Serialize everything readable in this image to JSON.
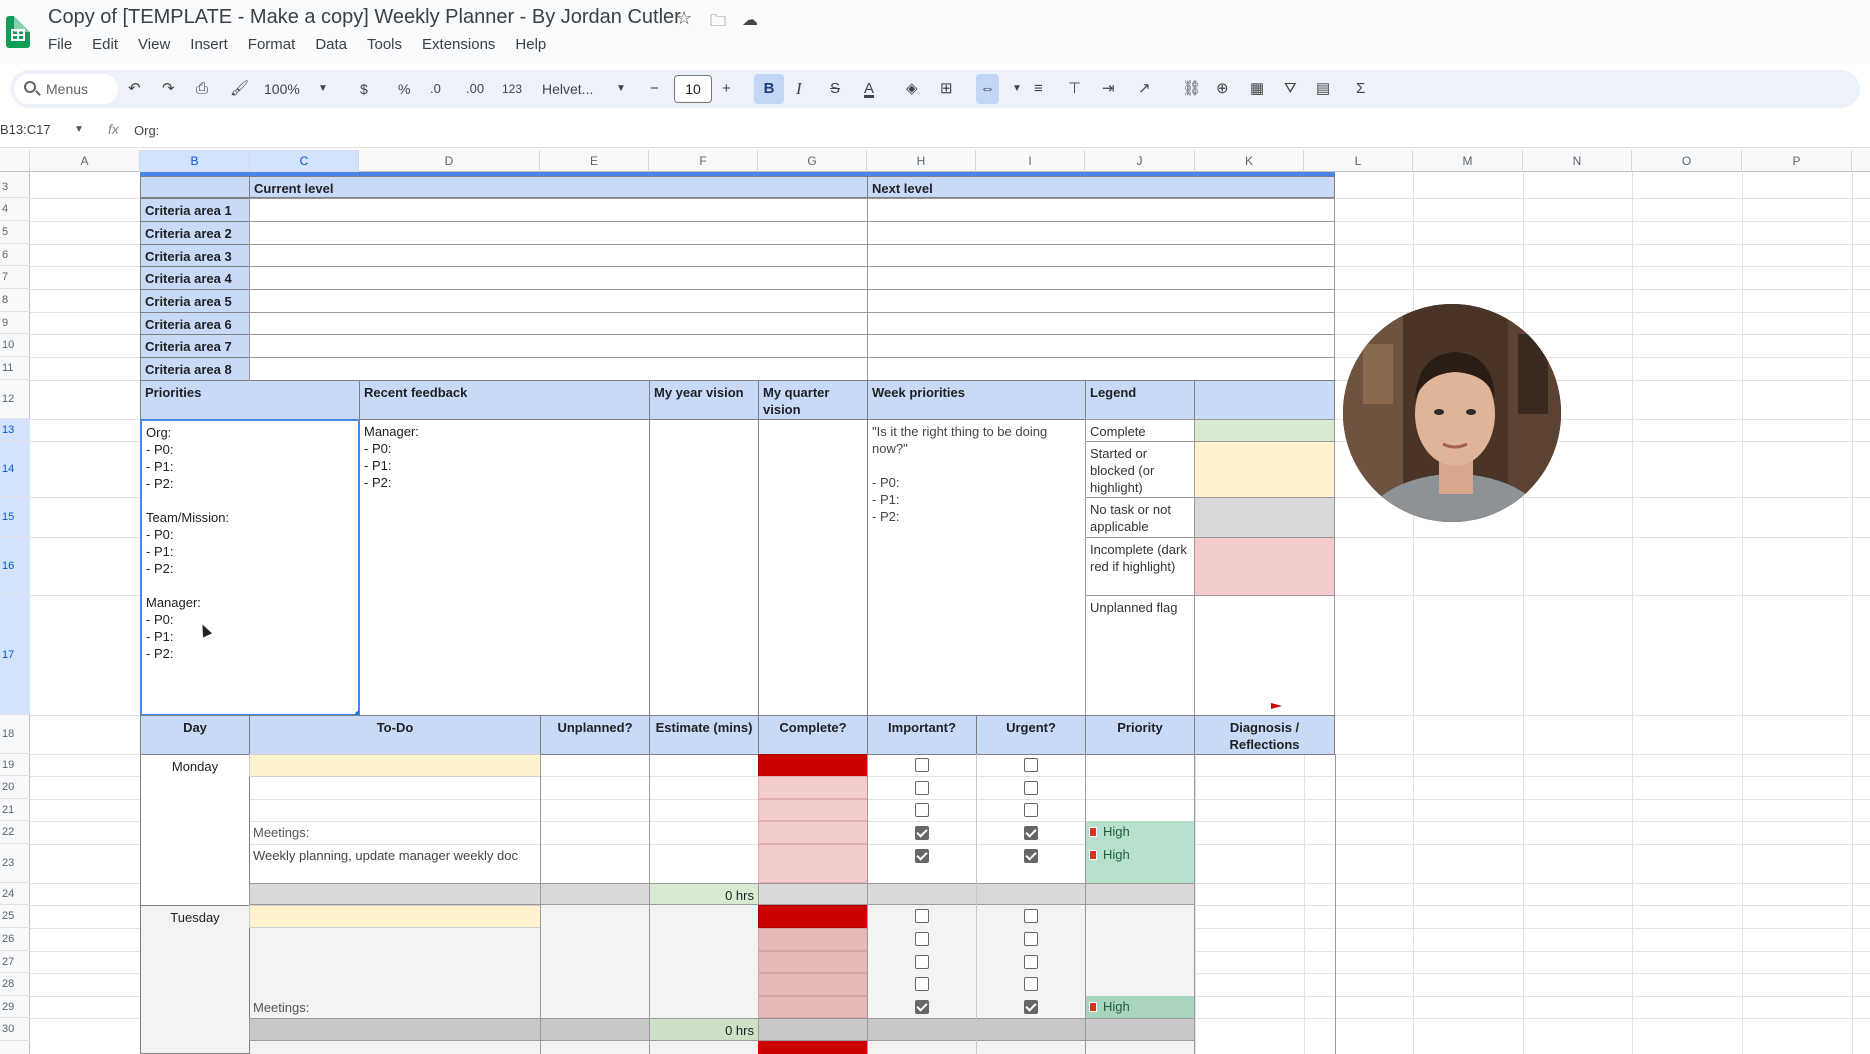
{
  "title_bar": {
    "doc_title": "Copy of [TEMPLATE - Make a copy] Weekly Planner - By Jordan Cutler",
    "menus": [
      "File",
      "Edit",
      "View",
      "Insert",
      "Format",
      "Data",
      "Tools",
      "Extensions",
      "Help"
    ]
  },
  "toolbar": {
    "search_label": "Menus",
    "zoom": "100%",
    "currency": "$",
    "percent": "%",
    "dec_decrease": ".0",
    "dec_increase": ".00",
    "number_format": "123",
    "font": "Helvet...",
    "font_size": "10",
    "bold": "B",
    "italic": "I",
    "minus": "−",
    "plus": "+",
    "sum": "Σ"
  },
  "formula_bar": {
    "name_box": "B13:C17",
    "content": "Org:"
  },
  "columns": [
    "A",
    "B",
    "C",
    "D",
    "E",
    "F",
    "G",
    "H",
    "I",
    "J",
    "K",
    "L",
    "M",
    "N",
    "O",
    "P"
  ],
  "rows": [
    "3",
    "4",
    "5",
    "6",
    "7",
    "8",
    "9",
    "10",
    "11",
    "12",
    "13",
    "14",
    "15",
    "16",
    "17",
    "18",
    "19",
    "20",
    "21",
    "22",
    "23",
    "24",
    "25",
    "26",
    "27",
    "28",
    "29",
    "30"
  ],
  "sheet": {
    "current_level": "Current level",
    "next_level": "Next level",
    "criteria": [
      "Criteria area 1",
      "Criteria area 2",
      "Criteria area 3",
      "Criteria area 4",
      "Criteria area 5",
      "Criteria area 6",
      "Criteria area 7",
      "Criteria area 8"
    ],
    "sections": {
      "priorities": "Priorities",
      "recent_feedback": "Recent feedback",
      "year_vision": "My year vision",
      "quarter_vision": "My quarter vision",
      "week_priorities": "Week priorities",
      "legend": "Legend"
    },
    "priorities_text": "Org:\n- P0:\n- P1:\n- P2:\n\nTeam/Mission:\n- P0:\n- P1:\n- P2:\n\nManager:\n- P0:\n- P1:\n- P2:",
    "feedback_text": "Manager:\n- P0:\n- P1:\n- P2:",
    "week_priorities_text": "\"Is it the right thing to be doing now?\"\n\n- P0:\n- P1:\n- P2:",
    "legend_items": [
      {
        "label": "Complete",
        "color": "#d9ead3"
      },
      {
        "label": "Started or blocked (or highlight)",
        "color": "#fff2cc"
      },
      {
        "label": "No task or not applicable",
        "color": "#d9d9d9"
      },
      {
        "label": "Incomplete (dark red if highlight)",
        "color": "#f4cccc"
      },
      {
        "label": "Unplanned flag",
        "color": "#ffffff"
      }
    ],
    "table_headers": {
      "day": "Day",
      "todo": "To-Do",
      "unplanned": "Unplanned?",
      "estimate": "Estimate (mins)",
      "complete": "Complete?",
      "important": "Important?",
      "urgent": "Urgent?",
      "priority": "Priority",
      "diagnosis": "Diagnosis / Reflections"
    },
    "monday": {
      "day": "Monday",
      "meetings": "Meetings:",
      "planning": "Weekly planning, update manager weekly doc",
      "total": "0 hrs",
      "priority_1": "High",
      "priority_2": "High"
    },
    "tuesday": {
      "day": "Tuesday",
      "meetings": "Meetings:",
      "total": "0 hrs",
      "priority_1": "High"
    }
  },
  "colors": {
    "header_blue": "#c9daf8",
    "complete_red": "#cc0000",
    "incomplete_pink": "#f4cccc",
    "started_yellow": "#fff2cc",
    "na_gray": "#d9d9d9",
    "total_green": "#d9ead3",
    "priority_green": "#b7e1cd"
  }
}
